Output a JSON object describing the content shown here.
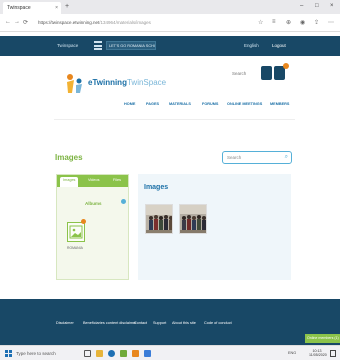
{
  "browser": {
    "tab_title": "Twinspace",
    "tab_close": "×",
    "new_tab": "+",
    "window_controls": [
      "–",
      "□",
      "×"
    ],
    "url_host": "https://twinspace.etwinning.net",
    "url_path": "/134964/materials/images",
    "nav": [
      "←",
      "→",
      "⟳"
    ]
  },
  "sitebar": {
    "twinspace": "Twinspace",
    "select_value": "LET'S GO ROMANIA SCHOOL",
    "language": "English",
    "logout": "Logout"
  },
  "header": {
    "logo_part1": "eTwinning",
    "logo_part2": "TwinSpace",
    "search_label": "Search",
    "menu": [
      "HOME",
      "PAGES",
      "MATERIALS",
      "FORUMS",
      "ONLINE MEETINGS",
      "MEMBERS"
    ]
  },
  "main": {
    "title": "Images",
    "search_placeholder": "Search",
    "left_tabs": [
      "Images",
      "Videos",
      "Files"
    ],
    "albums_label": "Albums",
    "album_name": "ROMANIA",
    "right_title": "Images"
  },
  "footer": {
    "links": [
      "Disclaimer",
      "Beneficiaries content disclaimer",
      "Contact",
      "Support",
      "About this site",
      "Code of conduct"
    ],
    "online": "Online members (1)"
  },
  "taskbar": {
    "search_placeholder": "Type here to search",
    "tray": "ENG",
    "time": "10:13",
    "date": "11/05/2020"
  },
  "colors": {
    "site_blue": "#184866",
    "green": "#8bc34a",
    "link_blue": "#1a6fa6",
    "accent_orange": "#e8871e"
  }
}
